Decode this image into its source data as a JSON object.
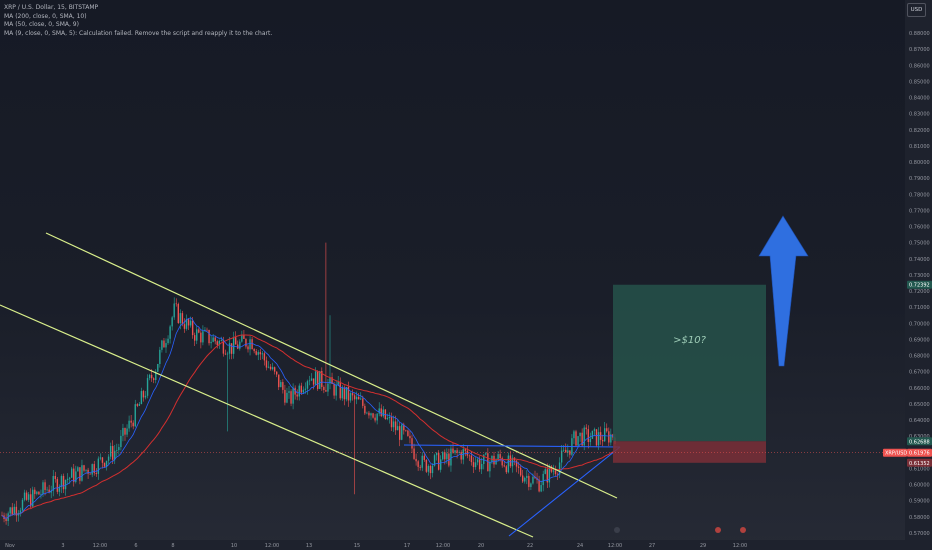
{
  "legend": {
    "symbol": "XRP / U.S. Dollar, 15, BITSTAMP",
    "ma200": "MA (200, close, 0, SMA, 10)",
    "ma50": "MA (50, close, 0, SMA, 9)",
    "ma9": "MA (9, close, 0, SMA, 5): Calculation failed. Remove the script and reapply it to the chart."
  },
  "currency_button": "USD",
  "colors": {
    "bull": "#26a69a",
    "bear": "#ef5350",
    "ma_red": "#d32f2f",
    "ma_blue": "#2962ff",
    "channel": "#d9ef8b",
    "target_zone": "#26524a",
    "stop_zone": "#7a2f37",
    "arrow": "#2f6fe0"
  },
  "chart_data": {
    "type": "candlestick",
    "title": "XRP / U.S. Dollar, 15, BITSTAMP",
    "ylim": [
      0.566,
      0.895
    ],
    "y_ticks": [
      "0.88000",
      "0.87000",
      "0.86000",
      "0.85000",
      "0.84000",
      "0.83000",
      "0.82000",
      "0.81000",
      "0.80000",
      "0.79000",
      "0.78000",
      "0.77000",
      "0.76000",
      "0.75000",
      "0.74000",
      "0.73000",
      "0.72000",
      "0.71000",
      "0.70000",
      "0.69000",
      "0.68000",
      "0.67000",
      "0.66000",
      "0.65000",
      "0.64000",
      "0.63000",
      "0.62000",
      "0.61000",
      "0.60000",
      "0.59000",
      "0.58000",
      "0.57000"
    ],
    "x_ticks": [
      "Nov",
      "3",
      "12:00",
      "6",
      "8",
      "10",
      "12:00",
      "13",
      "15",
      "17",
      "12:00",
      "20",
      "22",
      "24",
      "12:00",
      "27",
      "29",
      "12:00"
    ],
    "price_close": [
      0.581,
      0.588,
      0.595,
      0.602,
      0.607,
      0.613,
      0.622,
      0.645,
      0.672,
      0.708,
      0.694,
      0.69,
      0.685,
      0.69,
      0.672,
      0.652,
      0.668,
      0.662,
      0.655,
      0.648,
      0.641,
      0.63,
      0.612,
      0.615,
      0.62,
      0.613,
      0.616,
      0.608,
      0.601,
      0.612,
      0.63,
      0.629,
      0.631
    ],
    "price_labels": {
      "target_top": "0.72392",
      "entry": "0.62688",
      "current": "XRP/USD",
      "current_value": "0.61976",
      "stop": "0.61352"
    },
    "annotations": {
      "target_note": ">$10?",
      "target_top": 0.72392,
      "entry": 0.62688,
      "stop": 0.61352,
      "current": 0.61976
    },
    "overlays": [
      "descending channel",
      "ascending triangle",
      "long position",
      "up arrow",
      "MA 200",
      "MA 50"
    ]
  }
}
